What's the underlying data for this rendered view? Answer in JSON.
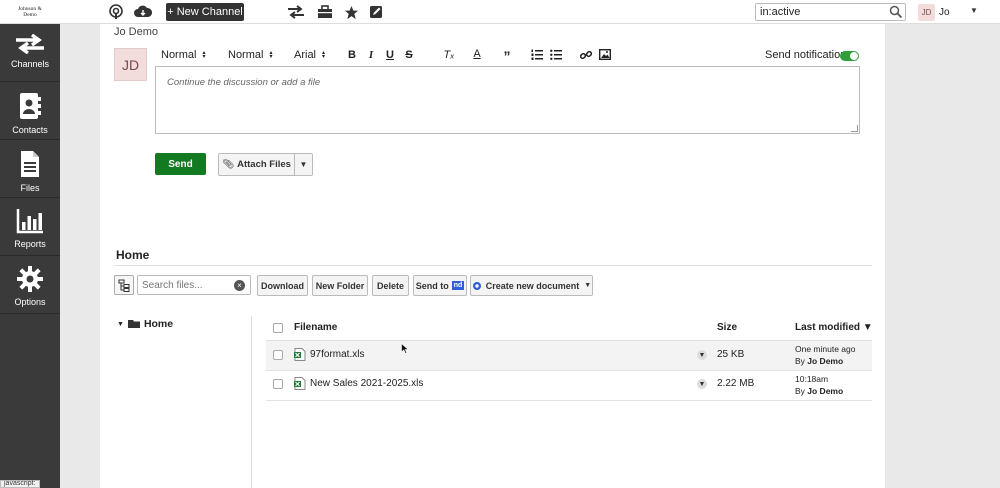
{
  "logo": {
    "line1": "Johnson &",
    "line2": "Demo"
  },
  "topbar": {
    "new_channel_label": "+ New Channel",
    "search_value": "in:active",
    "user_initials": "JD",
    "user_name": "Jo"
  },
  "sidebar": {
    "items": [
      {
        "label": "Channels",
        "icon": "arrows-icon"
      },
      {
        "label": "Contacts",
        "icon": "contacts-icon"
      },
      {
        "label": "Files",
        "icon": "file-icon"
      },
      {
        "label": "Reports",
        "icon": "chart-icon"
      },
      {
        "label": "Options",
        "icon": "gear-icon"
      }
    ]
  },
  "composer": {
    "user_name": "Jo Demo",
    "avatar_initials": "JD",
    "toolbar": {
      "style1": "Normal",
      "style2": "Normal",
      "font": "Arial"
    },
    "notification_label": "Send notification",
    "notification_on": true,
    "placeholder": "Continue the discussion or add a file",
    "send_label": "Send",
    "attach_label": "Attach Files"
  },
  "files": {
    "title": "Home",
    "search_placeholder": "Search files...",
    "buttons": {
      "download": "Download",
      "new_folder": "New Folder",
      "delete": "Delete",
      "send_to": "Send to",
      "send_to_badge": "nd",
      "create_doc": "Create new document"
    },
    "tree_root": "Home",
    "columns": {
      "filename": "Filename",
      "size": "Size",
      "last_modified": "Last modified ▼"
    },
    "rows": [
      {
        "name": "97format.xls",
        "size": "25 KB",
        "modified": "One minute ago",
        "by_prefix": "By ",
        "by": "Jo Demo"
      },
      {
        "name": "New Sales 2021-2025.xls",
        "size": "2.22 MB",
        "modified": "10:18am",
        "by_prefix": "By ",
        "by": "Jo Demo"
      }
    ]
  },
  "status_tip": "javascript:"
}
